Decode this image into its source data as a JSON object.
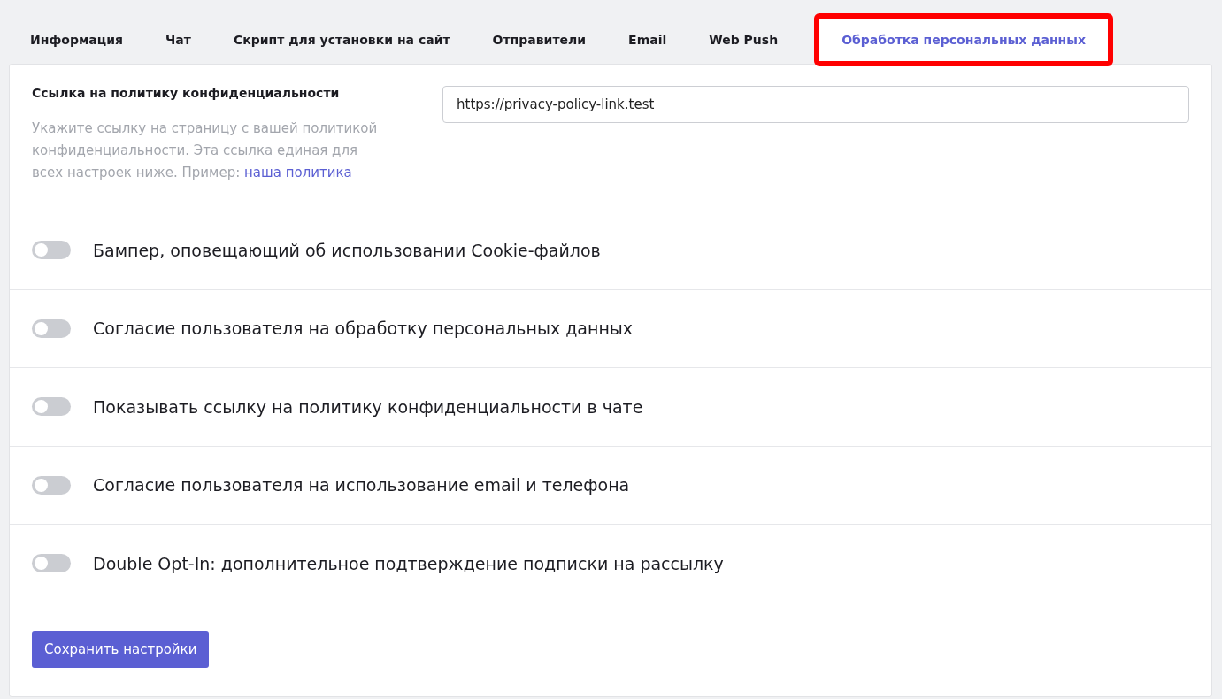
{
  "tabs": [
    {
      "label": "Информация",
      "selected": false
    },
    {
      "label": "Чат",
      "selected": false
    },
    {
      "label": "Скрипт для установки на сайт",
      "selected": false
    },
    {
      "label": "Отправители",
      "selected": false
    },
    {
      "label": "Email",
      "selected": false
    },
    {
      "label": "Web Push",
      "selected": false
    },
    {
      "label": "Обработка персональных данных",
      "selected": true
    }
  ],
  "policy": {
    "label": "Ссылка на политику конфиденциальности",
    "help": "Укажите ссылку на страницу с вашей политикой конфиденциальности. Эта ссылка единая для всех настроек ниже. Пример:",
    "link": "наша политика",
    "value": "https://privacy-policy-link.test"
  },
  "toggles": [
    {
      "label": "Бампер, оповещающий об использовании Cookie-файлов",
      "on": false
    },
    {
      "label": "Согласие пользователя на обработку персональных данных",
      "on": false
    },
    {
      "label": "Показывать ссылку на политику конфиденциальности в чате",
      "on": false
    },
    {
      "label": "Согласие пользователя на использование email и телефона",
      "on": false
    },
    {
      "label": "Double Opt-In: дополнительное подтверждение подписки на рассылку",
      "on": false
    }
  ],
  "save_button": "Сохранить настройки"
}
